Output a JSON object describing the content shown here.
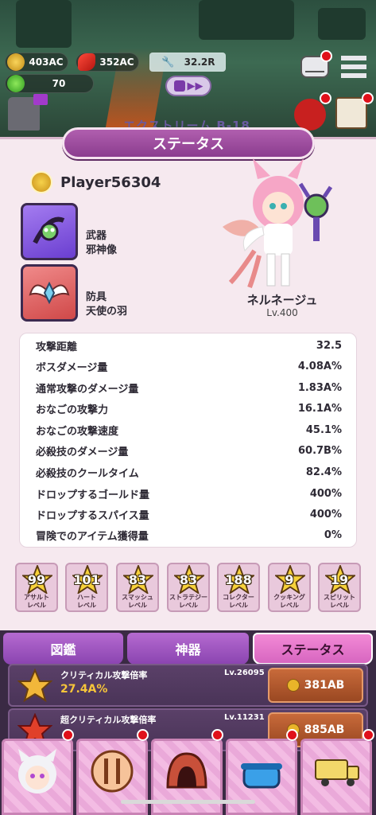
{
  "hud": {
    "coins_ac": "403AC",
    "spice_ac": "352AC",
    "gems": "70",
    "wrench_value": "32.2R"
  },
  "stage": {
    "label": "エクストリーム B-18"
  },
  "status_panel": {
    "title": "ステータス",
    "player_name": "Player56304",
    "weapon": {
      "type": "武器",
      "name": "邪神像"
    },
    "armor": {
      "type": "防具",
      "name": "天使の羽"
    },
    "hero": {
      "name": "ネルネージュ",
      "level": "Lv.400"
    },
    "stats": [
      {
        "label": "攻撃距離",
        "value": "32.5"
      },
      {
        "label": "ボスダメージ量",
        "value": "4.08A%"
      },
      {
        "label": "通常攻撃のダメージ量",
        "value": "1.83A%"
      },
      {
        "label": "おなごの攻撃力",
        "value": "16.1A%"
      },
      {
        "label": "おなごの攻撃速度",
        "value": "45.1%"
      },
      {
        "label": "必殺技のダメージ量",
        "value": "60.7B%"
      },
      {
        "label": "必殺技のクールタイム",
        "value": "82.4%"
      },
      {
        "label": "ドロップするゴールド量",
        "value": "400%"
      },
      {
        "label": "ドロップするスパイス量",
        "value": "400%"
      },
      {
        "label": "冒険でのアイテム獲得量",
        "value": "0%"
      }
    ],
    "skills": [
      {
        "level": "99",
        "name": "アサルト\nレベル"
      },
      {
        "level": "101",
        "name": "ハート\nレベル"
      },
      {
        "level": "83",
        "name": "スマッシュ\nレベル"
      },
      {
        "level": "83",
        "name": "ストラテジー\nレベル"
      },
      {
        "level": "188",
        "name": "コレクター\nレベル"
      },
      {
        "level": "9",
        "name": "クッキング\nレベル"
      },
      {
        "level": "19",
        "name": "スピリット\nレベル"
      }
    ]
  },
  "tabs": {
    "encyclopedia": "図鑑",
    "artifacts": "神器",
    "status": "ステータス"
  },
  "upgrades": [
    {
      "title": "クリティカル攻撃倍率",
      "level": "Lv.26095",
      "value": "27.4A%",
      "cost": "381AB"
    },
    {
      "title": "超クリティカル攻撃倍率",
      "level": "Lv.11231",
      "value": "",
      "cost": "885AB"
    }
  ],
  "colors": {
    "panel_bg": "#f6e9ef",
    "title_bar": "#8b3d8f",
    "active_tab": "#d766c0",
    "notification": "#e0101a"
  }
}
